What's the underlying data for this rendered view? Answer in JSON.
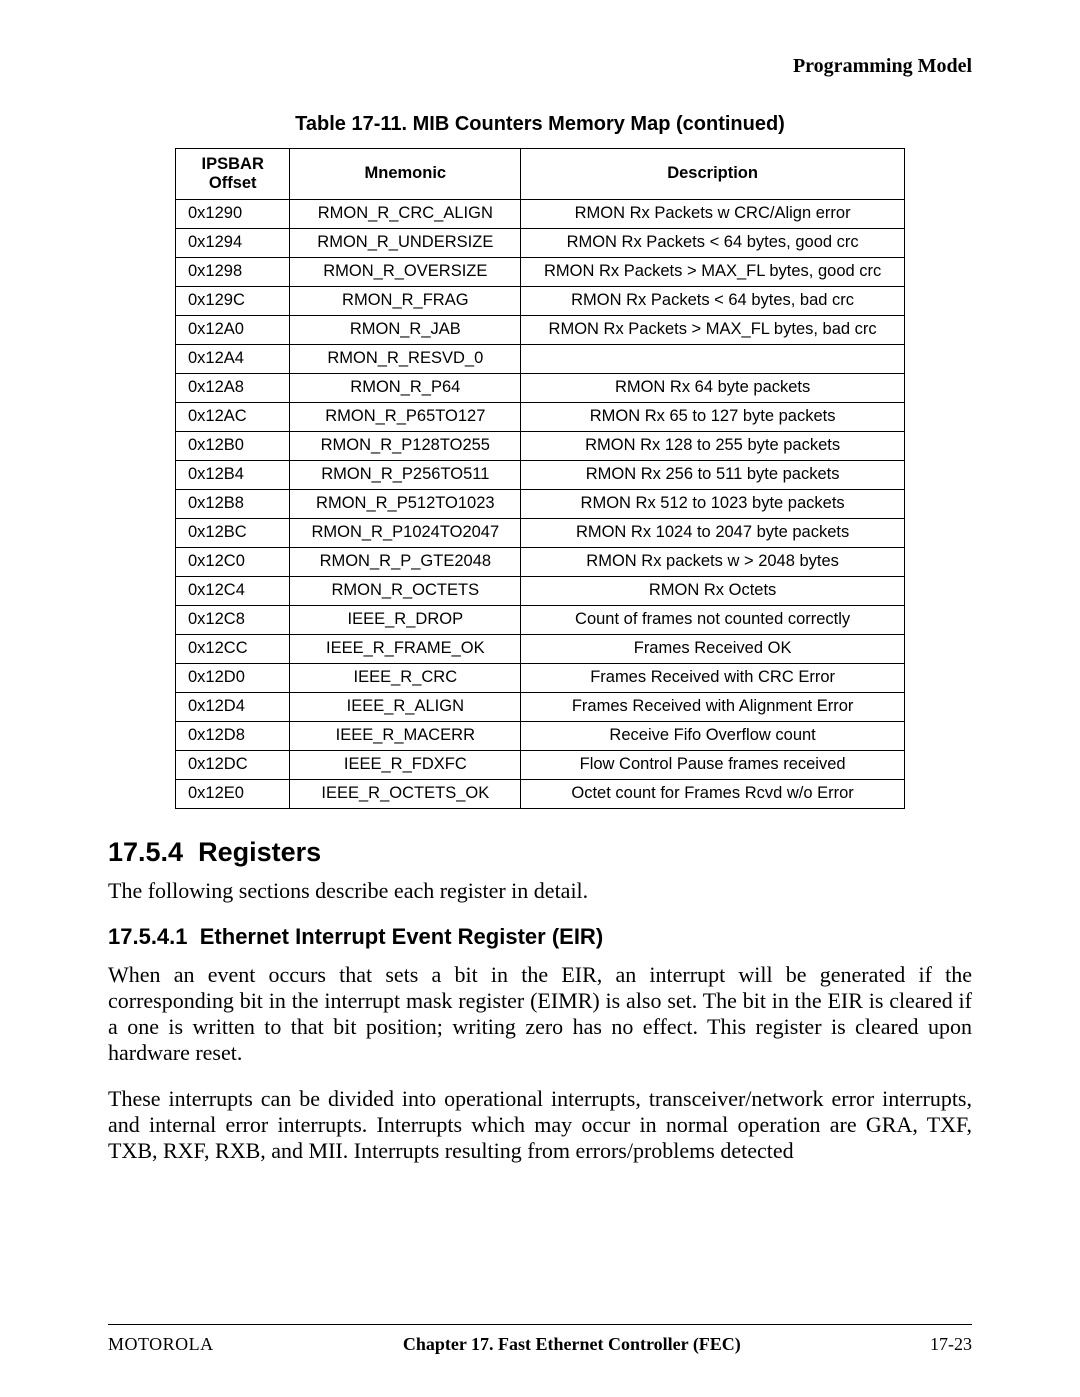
{
  "header": {
    "right": "Programming Model"
  },
  "table": {
    "caption": "Table 17-11. MIB Counters Memory Map (continued)",
    "headers": {
      "offset_l1": "IPSBAR",
      "offset_l2": "Offset",
      "mnemonic": "Mnemonic",
      "description": "Description"
    },
    "rows": [
      {
        "offset": "0x1290",
        "mnemonic": "RMON_R_CRC_ALIGN",
        "description": "RMON Rx Packets w CRC/Align error"
      },
      {
        "offset": "0x1294",
        "mnemonic": "RMON_R_UNDERSIZE",
        "description": "RMON Rx Packets < 64 bytes, good crc"
      },
      {
        "offset": "0x1298",
        "mnemonic": "RMON_R_OVERSIZE",
        "description": "RMON Rx Packets > MAX_FL bytes, good crc"
      },
      {
        "offset": "0x129C",
        "mnemonic": "RMON_R_FRAG",
        "description": "RMON Rx Packets < 64 bytes, bad crc"
      },
      {
        "offset": "0x12A0",
        "mnemonic": "RMON_R_JAB",
        "description": "RMON Rx Packets > MAX_FL bytes, bad crc"
      },
      {
        "offset": "0x12A4",
        "mnemonic": "RMON_R_RESVD_0",
        "description": ""
      },
      {
        "offset": "0x12A8",
        "mnemonic": "RMON_R_P64",
        "description": "RMON Rx 64 byte packets"
      },
      {
        "offset": "0x12AC",
        "mnemonic": "RMON_R_P65TO127",
        "description": "RMON Rx 65 to 127 byte packets"
      },
      {
        "offset": "0x12B0",
        "mnemonic": "RMON_R_P128TO255",
        "description": "RMON Rx 128 to 255 byte packets"
      },
      {
        "offset": "0x12B4",
        "mnemonic": "RMON_R_P256TO511",
        "description": "RMON Rx 256 to 511 byte packets"
      },
      {
        "offset": "0x12B8",
        "mnemonic": "RMON_R_P512TO1023",
        "description": "RMON Rx 512 to 1023 byte packets"
      },
      {
        "offset": "0x12BC",
        "mnemonic": "RMON_R_P1024TO2047",
        "description": "RMON Rx 1024 to 2047 byte packets"
      },
      {
        "offset": "0x12C0",
        "mnemonic": "RMON_R_P_GTE2048",
        "description": "RMON Rx packets w > 2048 bytes"
      },
      {
        "offset": "0x12C4",
        "mnemonic": "RMON_R_OCTETS",
        "description": "RMON Rx Octets"
      },
      {
        "offset": "0x12C8",
        "mnemonic": "IEEE_R_DROP",
        "description": "Count of frames not counted correctly"
      },
      {
        "offset": "0x12CC",
        "mnemonic": "IEEE_R_FRAME_OK",
        "description": "Frames Received OK"
      },
      {
        "offset": "0x12D0",
        "mnemonic": "IEEE_R_CRC",
        "description": "Frames Received with CRC Error"
      },
      {
        "offset": "0x12D4",
        "mnemonic": "IEEE_R_ALIGN",
        "description": "Frames Received with Alignment Error"
      },
      {
        "offset": "0x12D8",
        "mnemonic": "IEEE_R_MACERR",
        "description": "Receive Fifo Overflow count"
      },
      {
        "offset": "0x12DC",
        "mnemonic": "IEEE_R_FDXFC",
        "description": "Flow Control Pause frames received"
      },
      {
        "offset": "0x12E0",
        "mnemonic": "IEEE_R_OCTETS_OK",
        "description": "Octet count for Frames Rcvd w/o Error"
      }
    ]
  },
  "section_registers": {
    "number": "17.5.4",
    "title": "Registers",
    "intro": "The following sections describe each register in detail."
  },
  "subsection_eir": {
    "number": "17.5.4.1",
    "title": "Ethernet Interrupt Event Register (EIR)",
    "para1": "When an event occurs that sets a bit in the EIR, an interrupt will be generated if the corresponding bit in the interrupt mask register (EIMR) is also set. The bit in the EIR is cleared if a one is written to that bit position; writing zero has no effect. This register is cleared upon hardware reset.",
    "para2": "These interrupts can be divided into operational interrupts, transceiver/network error interrupts, and internal error interrupts. Interrupts which may occur in normal operation are GRA, TXF, TXB, RXF, RXB, and MII. Interrupts resulting from errors/problems detected"
  },
  "footer": {
    "left": "MOTOROLA",
    "center": "Chapter 17.  Fast Ethernet Controller (FEC)",
    "right": "17-23"
  }
}
